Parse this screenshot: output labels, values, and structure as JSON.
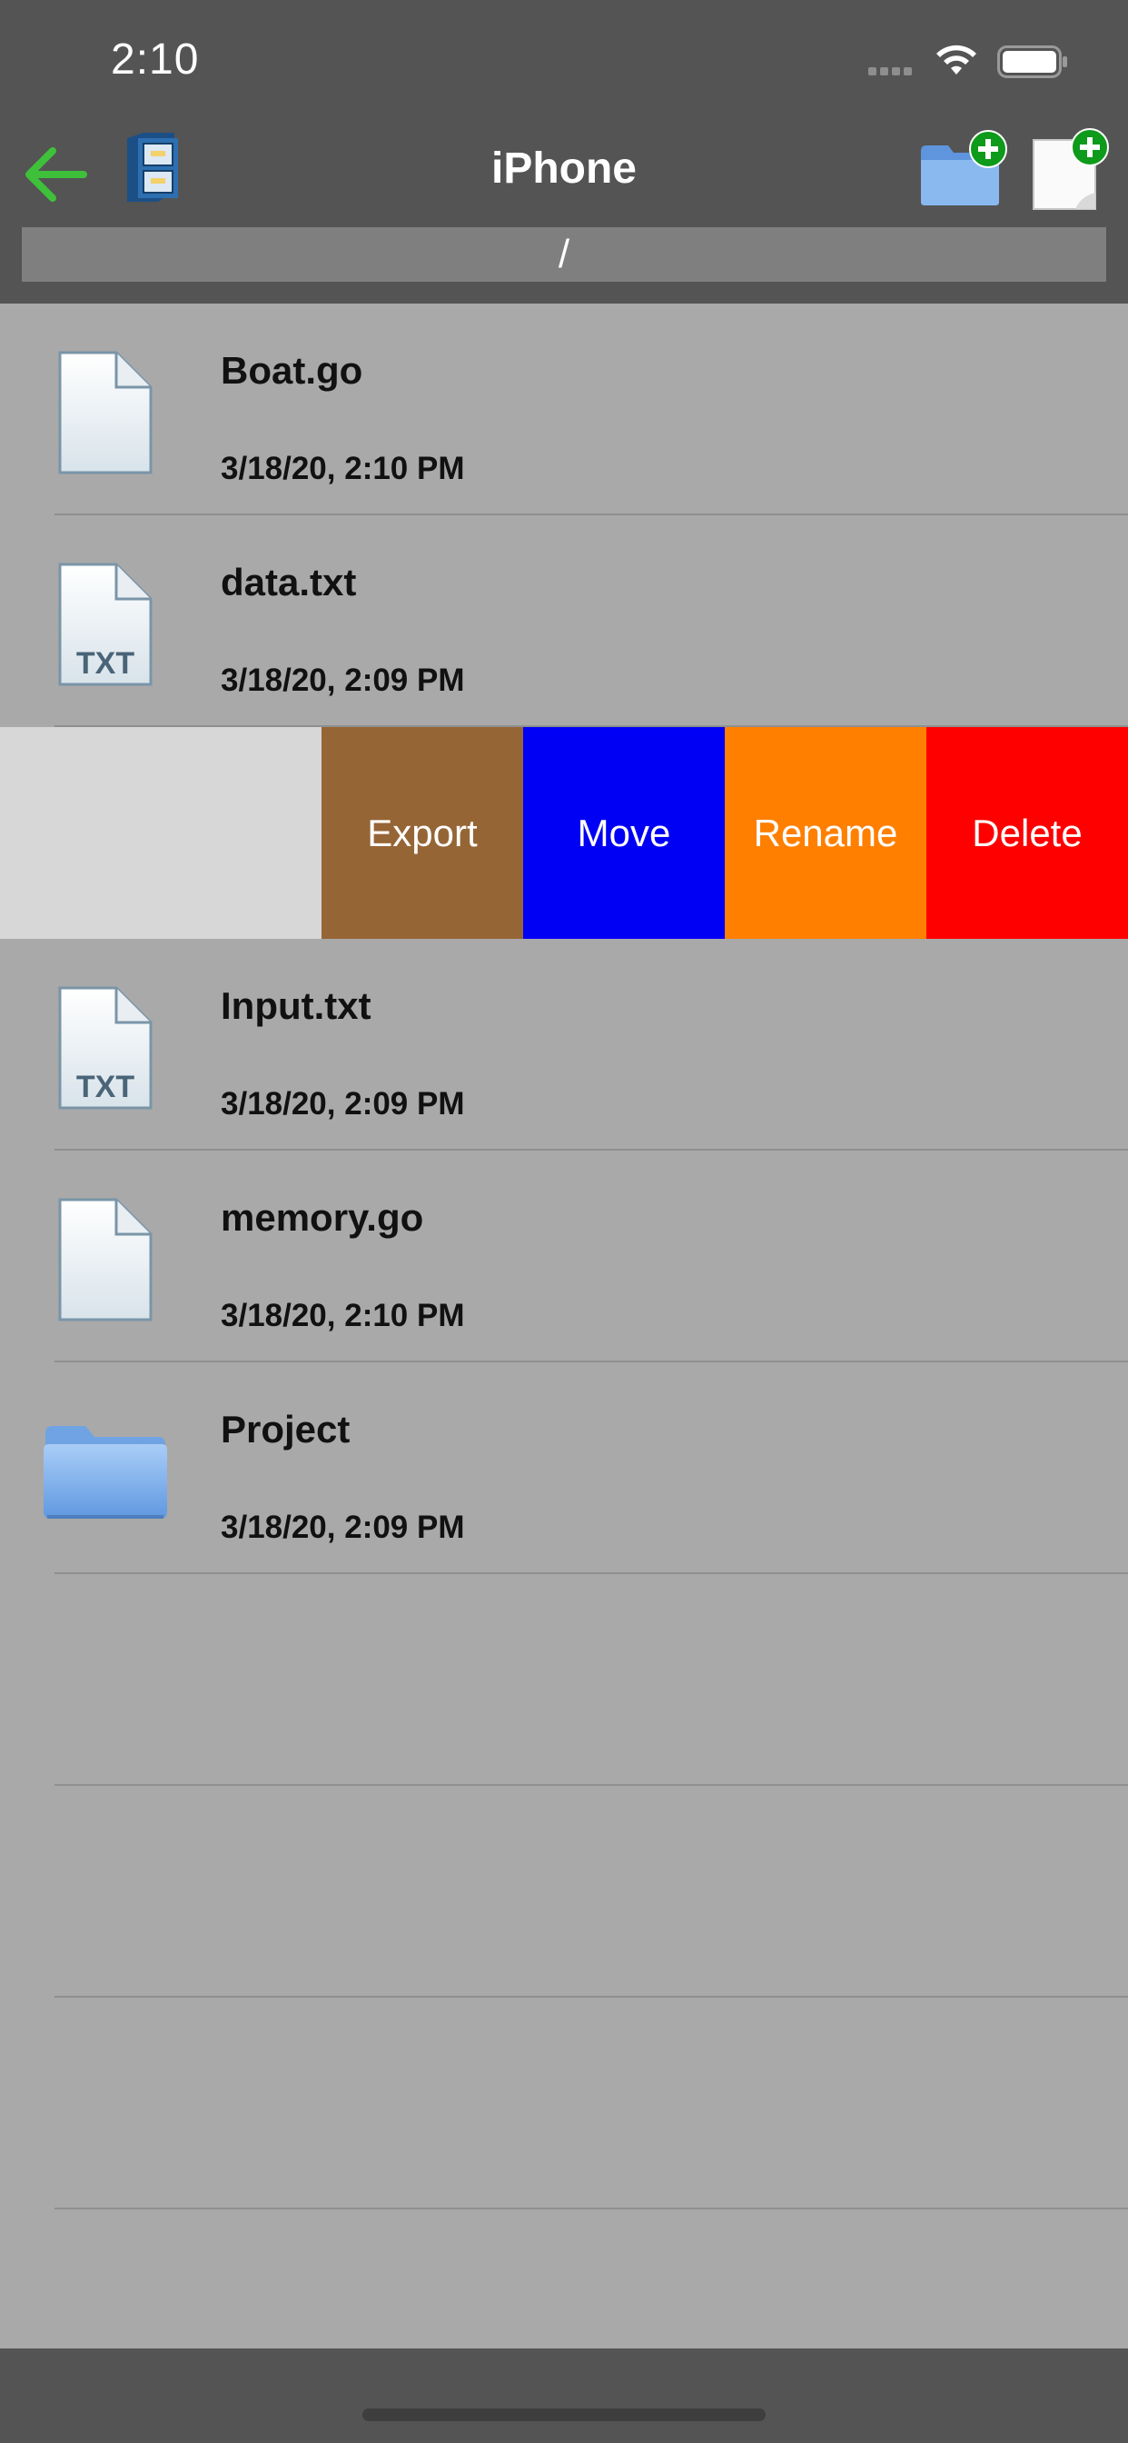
{
  "status_bar": {
    "time": "2:10"
  },
  "nav": {
    "title": "iPhone",
    "path": "/"
  },
  "files": [
    {
      "name": "Boat.go",
      "date": "3/18/20, 2:10 PM",
      "kind": "file-icon"
    },
    {
      "name": "data.txt",
      "date": "3/18/20, 2:09 PM",
      "kind": "txt-file-icon",
      "badge": "TXT"
    },
    {
      "name": "Input.txt",
      "date": "3/18/20, 2:09 PM",
      "kind": "txt-file-icon",
      "badge": "TXT"
    },
    {
      "name": "memory.go",
      "date": "3/18/20, 2:10 PM",
      "kind": "file-icon"
    },
    {
      "name": "Project",
      "date": "3/18/20, 2:09 PM",
      "kind": "folder-icon"
    }
  ],
  "swipe_actions": {
    "export": "Export",
    "move": "Move",
    "rename": "Rename",
    "delete": "Delete"
  },
  "colors": {
    "export": "#966536",
    "move": "#0000f5",
    "rename": "#ff7f00",
    "delete": "#fe0000",
    "back_arrow": "#3fc03a"
  }
}
